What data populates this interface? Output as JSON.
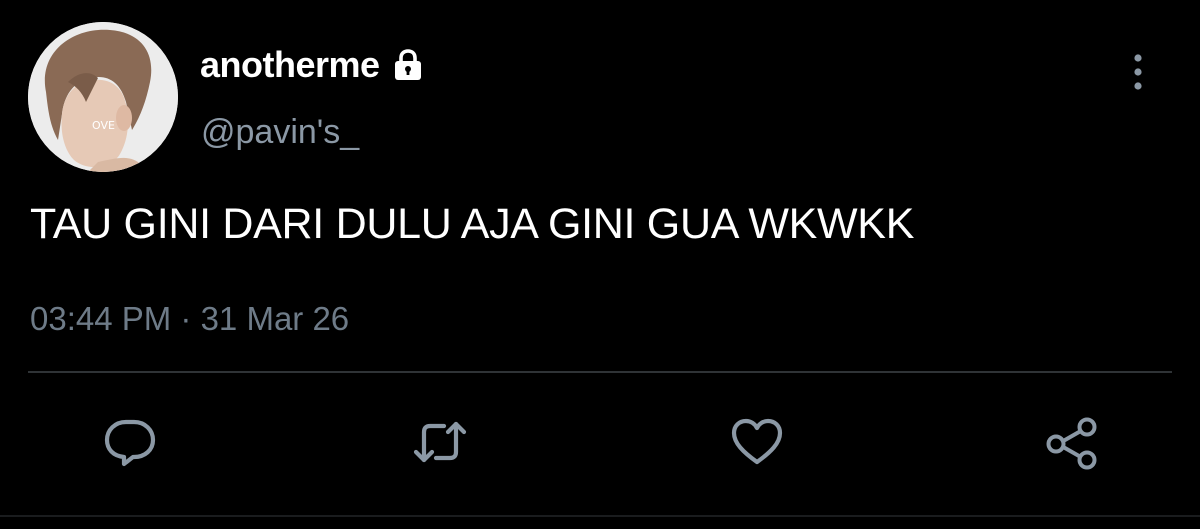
{
  "user": {
    "display_name": "anotherme",
    "handle": "@pavin's_",
    "avatar_overlay_text": "OVE",
    "protected_icon": "lock-icon"
  },
  "tweet": {
    "text": "TAU GINI DARI DULU AJA GINI GUA WKWKK",
    "time": "03:44 PM",
    "separator": " · ",
    "date": "31 Mar 26"
  },
  "actions": {
    "reply_icon": "reply-icon",
    "retweet_icon": "retweet-icon",
    "like_icon": "heart-icon",
    "share_icon": "share-icon"
  },
  "colors": {
    "background": "#000000",
    "primary_text": "#ffffff",
    "secondary_text": "#8b98a5",
    "icon": "#8b98a5",
    "divider": "#2f3336"
  }
}
